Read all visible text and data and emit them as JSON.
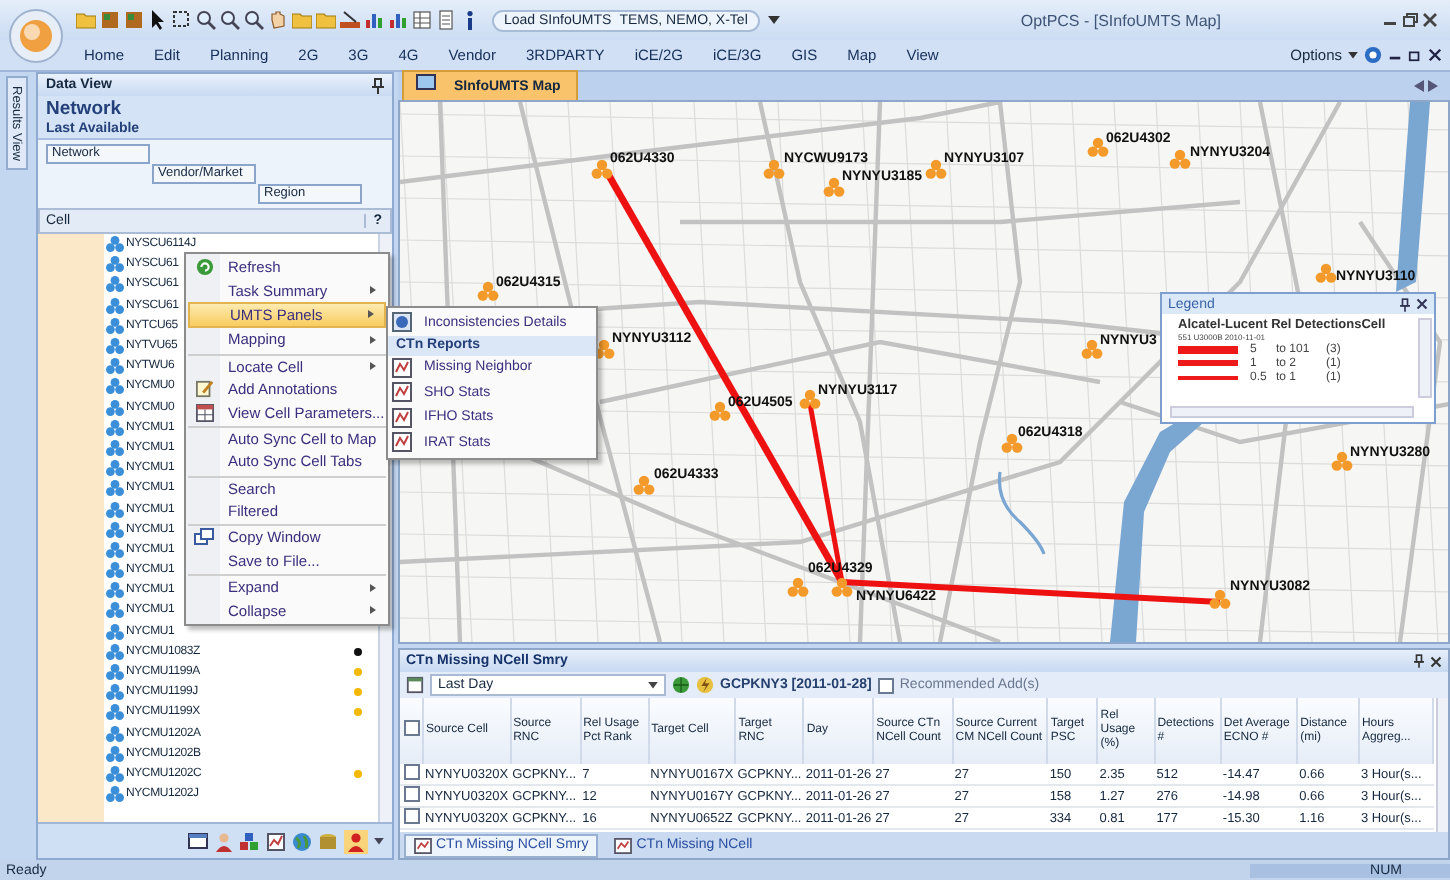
{
  "title_bar": {
    "load_label": "Load SInfoUMTS",
    "load_value": "TEMS, NEMO, X-Tel",
    "title": "OptPCS - [SInfoUMTS Map]"
  },
  "ribbon": {
    "tabs": [
      {
        "label": "Home",
        "selected": false
      },
      {
        "label": "Edit",
        "selected": false
      },
      {
        "label": "Planning",
        "selected": false
      },
      {
        "label": "2G",
        "selected": false
      },
      {
        "label": "3G",
        "selected": false
      },
      {
        "label": "4G",
        "selected": false
      },
      {
        "label": "Vendor",
        "selected": false
      },
      {
        "label": "3RDPARTY",
        "selected": false
      },
      {
        "label": "iCE/2G",
        "selected": false
      },
      {
        "label": "iCE/3G",
        "selected": false
      },
      {
        "label": "GIS",
        "selected": false
      },
      {
        "label": "Map",
        "selected": false
      },
      {
        "label": "View",
        "selected": false
      }
    ],
    "options": "Options"
  },
  "side_strip": {
    "label": "Results View"
  },
  "data_view": {
    "title": "Data View",
    "network_title": "Network",
    "last_available": "Last Available",
    "grouping": [
      "Network",
      "Vendor/Market",
      "Region"
    ],
    "column": "Cell",
    "help": "?",
    "cells": [
      {
        "name": "NYSCU6114J"
      },
      {
        "name": "NYSCU61"
      },
      {
        "name": "NYSCU61"
      },
      {
        "name": "NYSCU61"
      },
      {
        "name": "NYTCU65"
      },
      {
        "name": "NYTVU65"
      },
      {
        "name": "NYTWU6"
      },
      {
        "name": "NYCMU0"
      },
      {
        "name": "NYCMU0"
      },
      {
        "name": "NYCMU1"
      },
      {
        "name": "NYCMU1"
      },
      {
        "name": "NYCMU1"
      },
      {
        "name": "NYCMU1"
      },
      {
        "name": "NYCMU1"
      },
      {
        "name": "NYCMU1"
      },
      {
        "name": "NYCMU1"
      },
      {
        "name": "NYCMU1"
      },
      {
        "name": "NYCMU1"
      },
      {
        "name": "NYCMU1"
      },
      {
        "name": "NYCMU1"
      },
      {
        "name": "NYCMU1083Z",
        "color": "#111111"
      },
      {
        "name": "NYCMU1199A",
        "color": "#f5b800"
      },
      {
        "name": "NYCMU1199J",
        "color": "#f5b800"
      },
      {
        "name": "NYCMU1199X",
        "color": "#f5b800"
      },
      {
        "name": "NYCMU1202A"
      },
      {
        "name": "NYCMU1202B"
      },
      {
        "name": "NYCMU1202C",
        "color": "#f5b800"
      },
      {
        "name": "NYCMU1202J"
      }
    ]
  },
  "context_menu": {
    "items": [
      {
        "label": "Refresh",
        "submenu": false,
        "selected": false
      },
      {
        "label": "Task Summary",
        "submenu": true,
        "selected": false
      },
      {
        "label": "UMTS Panels",
        "submenu": true,
        "selected": true
      },
      {
        "label": "Mapping",
        "submenu": true,
        "selected": false
      },
      {
        "label": "Locate Cell",
        "submenu": true,
        "selected": false,
        "separator": true
      },
      {
        "label": "Add Annotations",
        "submenu": false,
        "selected": false
      },
      {
        "label": "View Cell Parameters...",
        "submenu": false,
        "selected": false
      },
      {
        "label": "Auto Sync Cell to Map",
        "submenu": false,
        "selected": false,
        "separator": true
      },
      {
        "label": "Auto Sync Cell Tabs",
        "submenu": false,
        "selected": false
      },
      {
        "label": "Search",
        "submenu": false,
        "selected": false,
        "separator": true
      },
      {
        "label": "Filtered",
        "submenu": false,
        "selected": false
      },
      {
        "label": "Copy Window",
        "submenu": false,
        "selected": false,
        "separator": true
      },
      {
        "label": "Save to File...",
        "submenu": false,
        "selected": false
      },
      {
        "label": "Expand",
        "submenu": true,
        "selected": false,
        "separator": true
      },
      {
        "label": "Collapse",
        "submenu": true,
        "selected": false
      }
    ]
  },
  "submenu": {
    "items": [
      {
        "kind": "item",
        "label": "Inconsistencies Details"
      },
      {
        "kind": "header",
        "label": "CTn Reports"
      },
      {
        "kind": "item",
        "label": "Missing Neighbor"
      },
      {
        "kind": "item",
        "label": "SHO Stats"
      },
      {
        "kind": "item",
        "label": "IFHO Stats"
      },
      {
        "kind": "item",
        "label": "IRAT Stats"
      }
    ]
  },
  "map": {
    "tab": {
      "label": "SInfoUMTS Map",
      "selected": true
    },
    "cells": [
      {
        "label": "062U4330"
      },
      {
        "label": "NYCWU9173"
      },
      {
        "label": "NYNYU3185"
      },
      {
        "label": "NYNYU3107"
      },
      {
        "label": "062U4302"
      },
      {
        "label": "NYNYU3204"
      },
      {
        "label": "062U4315"
      },
      {
        "label": "NYNYU3110"
      },
      {
        "label": "NYNYU3112"
      },
      {
        "label": "NYNYU3"
      },
      {
        "label": "062U4505"
      },
      {
        "label": "NYNYU3117"
      },
      {
        "label": "062U4318"
      },
      {
        "label": "062U4333"
      },
      {
        "label": "NYNYU3280"
      },
      {
        "label": "062U4329"
      },
      {
        "label": "NYNYU6422"
      },
      {
        "label": "NYNYU3082"
      }
    ],
    "legend": {
      "title": "Legend",
      "heading": "Alcatel-Lucent Rel DetectionsCell",
      "subheading": "551 U3000B 2010-11-01",
      "rows": [
        {
          "low": "5",
          "high": "to 101",
          "count": "(3)"
        },
        {
          "low": "1",
          "high": "to 2",
          "count": "(1)"
        },
        {
          "low": "0.5",
          "high": "to 1",
          "count": "(1)"
        }
      ]
    }
  },
  "ncell_panel": {
    "title": "CTn Missing NCell Smry",
    "period": "Last Day",
    "run": "GCPKNY3 [2011-01-28]",
    "recommended": {
      "label": "Recommended Add(s)",
      "checked": false
    },
    "select_all": {
      "checked": false
    },
    "columns": [
      "Source Cell",
      "Source RNC",
      "Rel Usage Pct Rank",
      "Target Cell",
      "Target RNC",
      "Day",
      "Source CTn NCell Count",
      "Source Current CM NCell Count",
      "Target PSC",
      "Rel Usage (%)",
      "Detections #",
      "Det Average ECNO #",
      "Distance (mi)",
      "Hours Aggreg..."
    ],
    "rows": [
      {
        "checked": false,
        "cells": [
          "NYNYU0320X",
          "GCPKNY...",
          "7",
          "NYNYU0167X",
          "GCPKNY...",
          "2011-01-26",
          "27",
          "27",
          "150",
          "2.35",
          "512",
          "-14.47",
          "0.66",
          "3 Hour(s..."
        ]
      },
      {
        "checked": false,
        "cells": [
          "NYNYU0320X",
          "GCPKNY...",
          "12",
          "NYNYU0167Y",
          "GCPKNY...",
          "2011-01-26",
          "27",
          "27",
          "158",
          "1.27",
          "276",
          "-14.98",
          "0.66",
          "3 Hour(s..."
        ]
      },
      {
        "checked": false,
        "cells": [
          "NYNYU0320X",
          "GCPKNY...",
          "16",
          "NYNYU0652Z",
          "GCPKNY...",
          "2011-01-26",
          "27",
          "27",
          "334",
          "0.81",
          "177",
          "-15.30",
          "1.16",
          "3 Hour(s..."
        ]
      }
    ],
    "tabs": [
      {
        "label": "CTn Missing NCell Smry",
        "selected": true
      },
      {
        "label": "CTn Missing NCell",
        "selected": false
      }
    ]
  },
  "status_bar": {
    "left": "Ready",
    "right": "NUM"
  }
}
